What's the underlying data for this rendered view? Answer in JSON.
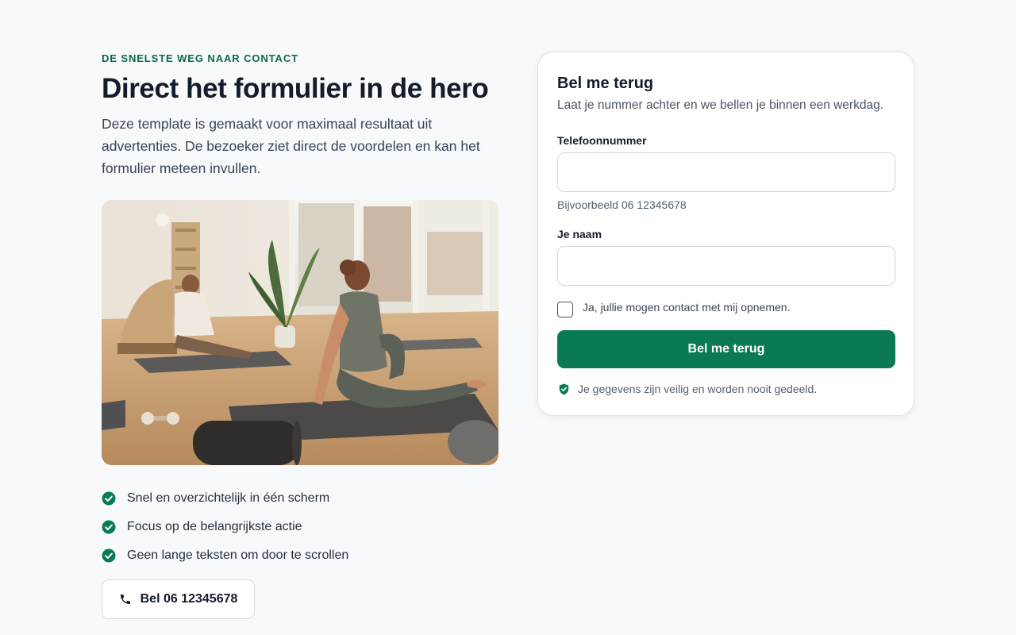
{
  "hero": {
    "eyebrow": "DE SNELSTE WEG NAAR CONTACT",
    "title": "Direct het formulier in de hero",
    "lead": "Deze template is gemaakt voor maximaal resultaat uit advertenties. De bezoeker ziet direct de voordelen en kan het formulier meteen invullen.",
    "image": "yoga-studio-photo",
    "benefits": [
      {
        "icon": "check-circle-icon",
        "text": "Snel en overzichtelijk in één scherm"
      },
      {
        "icon": "check-circle-icon",
        "text": "Focus op de belangrijkste actie"
      },
      {
        "icon": "check-circle-icon",
        "text": "Geen lange teksten om door te scrollen"
      }
    ],
    "call_button": {
      "icon": "phone-icon",
      "label": "Bel 06 12345678"
    }
  },
  "form": {
    "title": "Bel me terug",
    "subtitle": "Laat je nummer achter en we bellen je binnen een werkdag.",
    "phone_label": "Telefoonnummer",
    "phone_value": "",
    "phone_hint": "Bijvoorbeeld 06 12345678",
    "name_label": "Je naam",
    "name_value": "",
    "consent_label": "Ja, jullie mogen contact met mij opnemen.",
    "consent_checked": false,
    "submit_label": "Bel me terug",
    "privacy_icon": "shield-check-icon",
    "privacy_text": "Je gegevens zijn veilig en worden nooit gedeeld."
  },
  "colors": {
    "accent": "#0a7a54",
    "eyebrow": "#0a6b47",
    "background": "#f7f9fb",
    "heading": "#141c2b"
  }
}
